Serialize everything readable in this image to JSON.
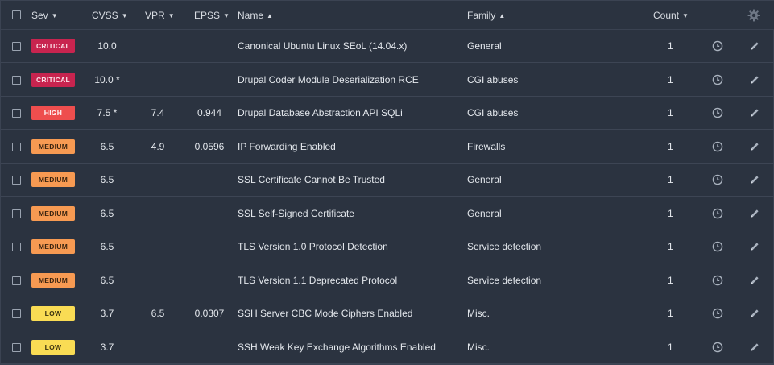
{
  "header": {
    "sev": "Sev",
    "cvss": "CVSS",
    "vpr": "VPR",
    "epss": "EPSS",
    "name": "Name",
    "family": "Family",
    "count": "Count",
    "sort_desc_glyph": "▼",
    "sort_asc_glyph": "▲"
  },
  "severity_colors": {
    "CRITICAL": "#c8244f",
    "HIGH": "#ee4e4e",
    "MEDIUM": "#f79a52",
    "LOW": "#f9dc54"
  },
  "rows": [
    {
      "sev": "CRITICAL",
      "cvss": "10.0",
      "vpr": "",
      "epss": "",
      "name": "Canonical Ubuntu Linux SEoL (14.04.x)",
      "family": "General",
      "count": "1"
    },
    {
      "sev": "CRITICAL",
      "cvss": "10.0 *",
      "vpr": "",
      "epss": "",
      "name": "Drupal Coder Module Deserialization RCE",
      "family": "CGI abuses",
      "count": "1"
    },
    {
      "sev": "HIGH",
      "cvss": "7.5 *",
      "vpr": "7.4",
      "epss": "0.944",
      "name": "Drupal Database Abstraction API SQLi",
      "family": "CGI abuses",
      "count": "1"
    },
    {
      "sev": "MEDIUM",
      "cvss": "6.5",
      "vpr": "4.9",
      "epss": "0.0596",
      "name": "IP Forwarding Enabled",
      "family": "Firewalls",
      "count": "1"
    },
    {
      "sev": "MEDIUM",
      "cvss": "6.5",
      "vpr": "",
      "epss": "",
      "name": "SSL Certificate Cannot Be Trusted",
      "family": "General",
      "count": "1"
    },
    {
      "sev": "MEDIUM",
      "cvss": "6.5",
      "vpr": "",
      "epss": "",
      "name": "SSL Self-Signed Certificate",
      "family": "General",
      "count": "1"
    },
    {
      "sev": "MEDIUM",
      "cvss": "6.5",
      "vpr": "",
      "epss": "",
      "name": "TLS Version 1.0 Protocol Detection",
      "family": "Service detection",
      "count": "1"
    },
    {
      "sev": "MEDIUM",
      "cvss": "6.5",
      "vpr": "",
      "epss": "",
      "name": "TLS Version 1.1 Deprecated Protocol",
      "family": "Service detection",
      "count": "1"
    },
    {
      "sev": "LOW",
      "cvss": "3.7",
      "vpr": "6.5",
      "epss": "0.0307",
      "name": "SSH Server CBC Mode Ciphers Enabled",
      "family": "Misc.",
      "count": "1"
    },
    {
      "sev": "LOW",
      "cvss": "3.7",
      "vpr": "",
      "epss": "",
      "name": "SSH Weak Key Exchange Algorithms Enabled",
      "family": "Misc.",
      "count": "1"
    }
  ]
}
